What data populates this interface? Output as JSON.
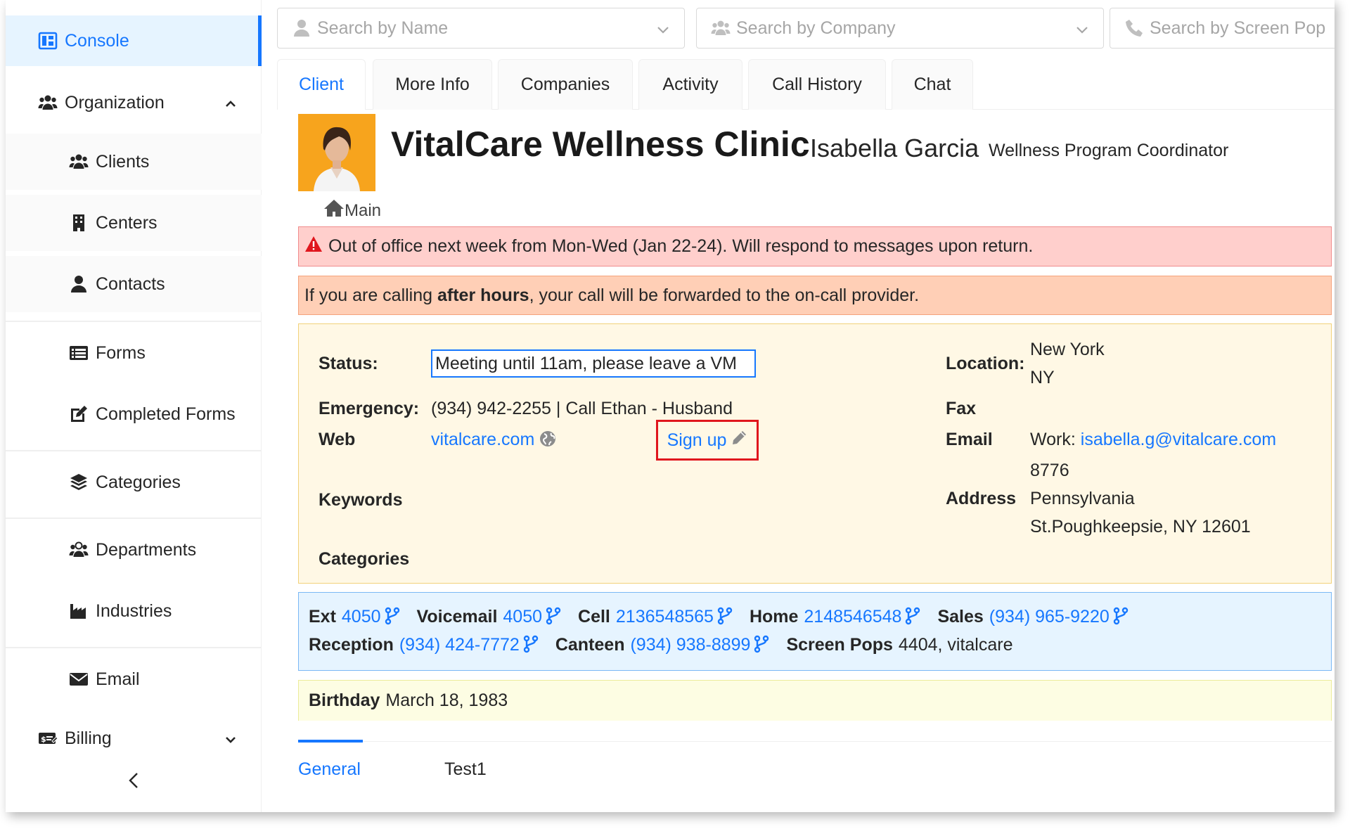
{
  "sidebar": {
    "console": "Console",
    "organization": "Organization",
    "clients": "Clients",
    "centers": "Centers",
    "contacts": "Contacts",
    "forms": "Forms",
    "completed_forms": "Completed Forms",
    "categories": "Categories",
    "departments": "Departments",
    "industries": "Industries",
    "email": "Email",
    "billing": "Billing"
  },
  "search": {
    "name_placeholder": "Search by Name",
    "company_placeholder": "Search by Company",
    "screenpop_placeholder": "Search by Screen Pop"
  },
  "tabs": [
    "Client",
    "More Info",
    "Companies",
    "Activity",
    "Call History",
    "Chat"
  ],
  "header": {
    "company": "VitalCare Wellness Clinic",
    "person": "Isabella Garcia",
    "role": "Wellness Program Coordinator",
    "location": "Main"
  },
  "alerts": {
    "warning": "Out of office next week from Mon-Wed (Jan 22-24). Will respond to messages upon return.",
    "after_hours_pre": "If you are calling ",
    "after_hours_bold": "after hours",
    "after_hours_post": ", your call will be forwarded to the on-call provider."
  },
  "info": {
    "status_label": "Status:",
    "status_value": "Meeting until 11am, please leave a VM",
    "emergency_label": "Emergency:",
    "emergency_value": "(934) 942-2255 | Call Ethan - Husband",
    "web_label": "Web",
    "web_value": "vitalcare.com",
    "signup_label": "Sign up",
    "keywords_label": "Keywords",
    "categories_label": "Categories",
    "location_label": "Location:",
    "location_line1": "New York",
    "location_line2": "NY",
    "fax_label": "Fax",
    "email_label": "Email",
    "email_prefix": "Work:",
    "email_value": "isabella.g@vitalcare.com",
    "address_label": "Address",
    "address_line1": "8776",
    "address_line2": "Pennsylvania",
    "address_line3": "St.Poughkeepsie, NY 12601"
  },
  "phones": {
    "row1": [
      {
        "label": "Ext",
        "value": "4050"
      },
      {
        "label": "Voicemail",
        "value": "4050"
      },
      {
        "label": "Cell",
        "value": "2136548565"
      },
      {
        "label": "Home",
        "value": "2148546548"
      },
      {
        "label": "Sales",
        "value": "(934) 965-9220"
      }
    ],
    "row2": [
      {
        "label": "Reception",
        "value": "(934) 424-7772"
      },
      {
        "label": "Canteen",
        "value": "(934) 938-8899"
      }
    ],
    "screen_pops_label": "Screen Pops",
    "screen_pops_value": "4404, vitalcare"
  },
  "birthday": {
    "label": "Birthday",
    "value": "March 18, 1983"
  },
  "bottom_tabs": [
    "General",
    "Test1"
  ],
  "colors": {
    "accent": "#1677ff",
    "alert_red": "#ffcfcc",
    "alert_orange": "#ffcfb6",
    "info_panel": "#fff8e5",
    "phones_panel": "#e6f4ff",
    "birthday_panel": "#fdfde3",
    "highlight_border": "#e0161d"
  }
}
